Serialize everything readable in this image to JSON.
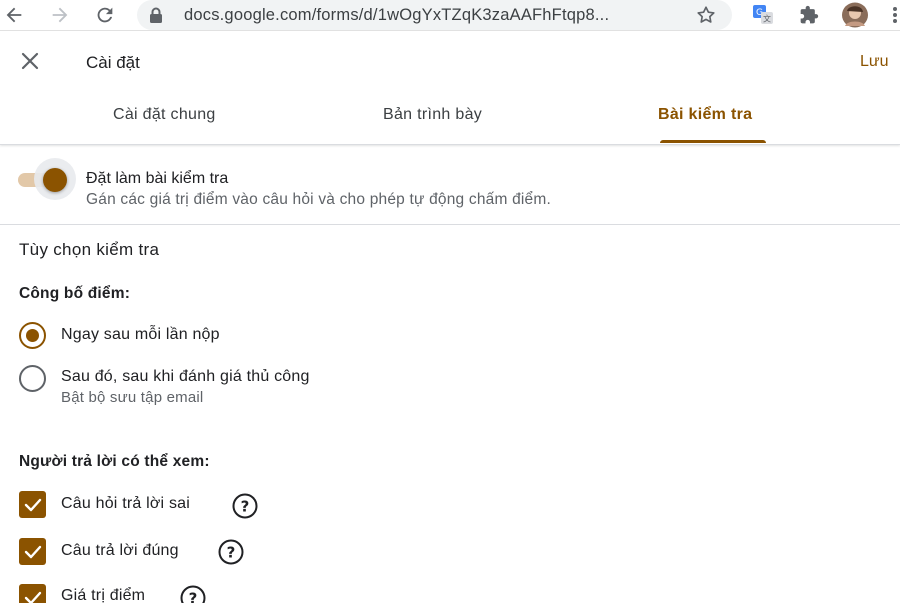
{
  "browser": {
    "url": "docs.google.com/forms/d/1wOgYxTZqK3zaAAFhFtqp8...",
    "icons": [
      "back-arrow-icon",
      "forward-arrow-icon",
      "reload-icon",
      "lock-icon",
      "star-icon",
      "translate-icon",
      "extensions-icon",
      "avatar",
      "menu-dots-icon"
    ]
  },
  "dialog": {
    "title": "Cài đặt",
    "save_label": "Lưu",
    "tabs": [
      {
        "label": "Cài đặt chung",
        "active": false
      },
      {
        "label": "Bản trình bày",
        "active": false
      },
      {
        "label": "Bài kiểm tra",
        "active": true
      }
    ]
  },
  "quiz": {
    "toggle_on": true,
    "title": "Đặt làm bài kiểm tra",
    "description": "Gán các giá trị điểm vào câu hỏi và cho phép tự động chấm điểm."
  },
  "options": {
    "section_title": "Tùy chọn kiểm tra",
    "release": {
      "heading": "Công bố điểm:",
      "choices": [
        {
          "label": "Ngay sau mỗi lần nộp",
          "checked": true
        },
        {
          "label": "Sau đó, sau khi đánh giá thủ công",
          "sub": "Bật bộ sưu tập email",
          "checked": false
        }
      ]
    },
    "respondent": {
      "heading": "Người trả lời có thể xem:",
      "items": [
        {
          "label": "Câu hỏi trả lời sai",
          "checked": true
        },
        {
          "label": "Câu trả lời đúng",
          "checked": true
        },
        {
          "label": "Giá trị điểm",
          "checked": true
        }
      ]
    }
  },
  "colors": {
    "accent": "#8b5300",
    "toggle_track": "#e2c8a8",
    "text": "#202124",
    "secondary_text": "#5f6368"
  }
}
